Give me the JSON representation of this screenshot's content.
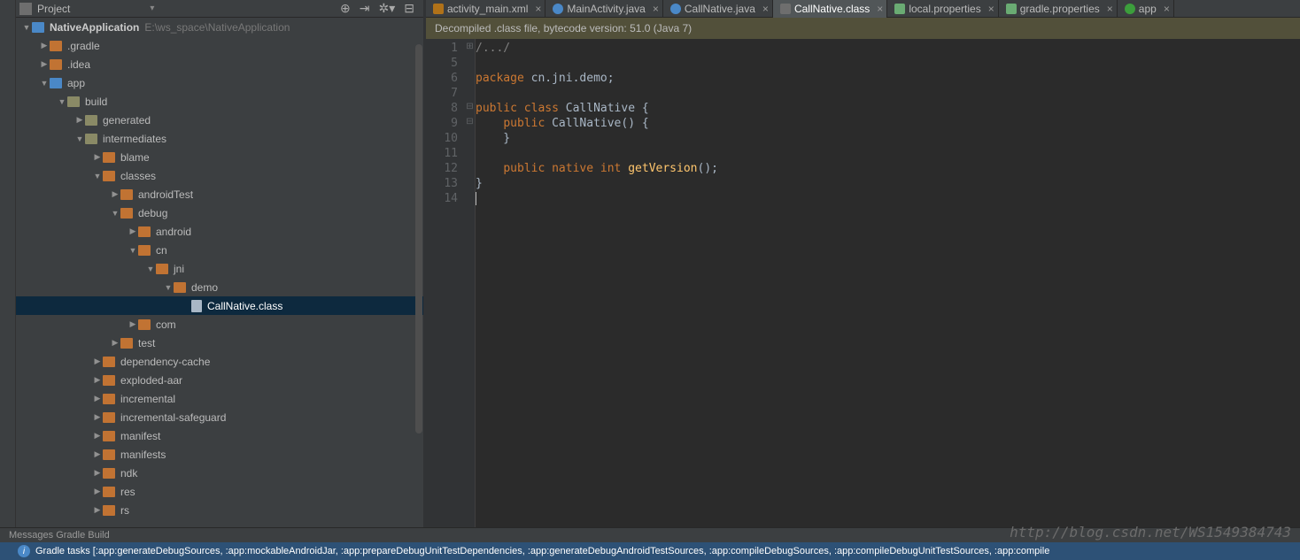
{
  "project_panel": {
    "title": "Project",
    "root": {
      "name": "NativeApplication",
      "path": "E:\\ws_space\\NativeApplication"
    }
  },
  "tree": {
    "gradle": ".gradle",
    "idea": ".idea",
    "app": "app",
    "build": "build",
    "generated": "generated",
    "intermediates": "intermediates",
    "blame": "blame",
    "classes": "classes",
    "androidTest": "androidTest",
    "debug": "debug",
    "android": "android",
    "cn": "cn",
    "jni": "jni",
    "demo": "demo",
    "callNativeClass": "CallNative.class",
    "com": "com",
    "test": "test",
    "dependencyCache": "dependency-cache",
    "explodedAar": "exploded-aar",
    "incremental": "incremental",
    "incrementalSafeguard": "incremental-safeguard",
    "manifest": "manifest",
    "manifests": "manifests",
    "ndk": "ndk",
    "res": "res",
    "rs": "rs"
  },
  "tabs": [
    {
      "label": "activity_main.xml",
      "icon": "xml"
    },
    {
      "label": "MainActivity.java",
      "icon": "class"
    },
    {
      "label": "CallNative.java",
      "icon": "class"
    },
    {
      "label": "CallNative.class",
      "icon": "cls2",
      "active": true
    },
    {
      "label": "local.properties",
      "icon": "prop"
    },
    {
      "label": "gradle.properties",
      "icon": "prop"
    },
    {
      "label": "app",
      "icon": "grad"
    }
  ],
  "banner": "Decompiled .class file, bytecode version: 51.0 (Java 7)",
  "gutter": [
    "1",
    "5",
    "6",
    "7",
    "8",
    "9",
    "10",
    "11",
    "12",
    "13",
    "14"
  ],
  "code": {
    "l1_cmt": "/.../",
    "l3_kw1": "package",
    "l3_rest": " cn.jni.demo;",
    "l5_kw1": "public",
    "l5_kw2": "class",
    "l5_name": "CallNative",
    "l5_brace": " {",
    "l6_kw": "public",
    "l6_name": "CallNative",
    "l6_rest": "() {",
    "l7": "    }",
    "l9_kw1": "public",
    "l9_kw2": "native",
    "l9_kw3": "int",
    "l9_name": "getVersion",
    "l9_rest": "();",
    "l10": "}"
  },
  "status": "Messages Gradle Build",
  "bottom": "Gradle tasks [:app:generateDebugSources, :app:mockableAndroidJar, :app:prepareDebugUnitTestDependencies, :app:generateDebugAndroidTestSources, :app:compileDebugSources, :app:compileDebugUnitTestSources, :app:compile",
  "watermark": "http://blog.csdn.net/WS1549384743"
}
